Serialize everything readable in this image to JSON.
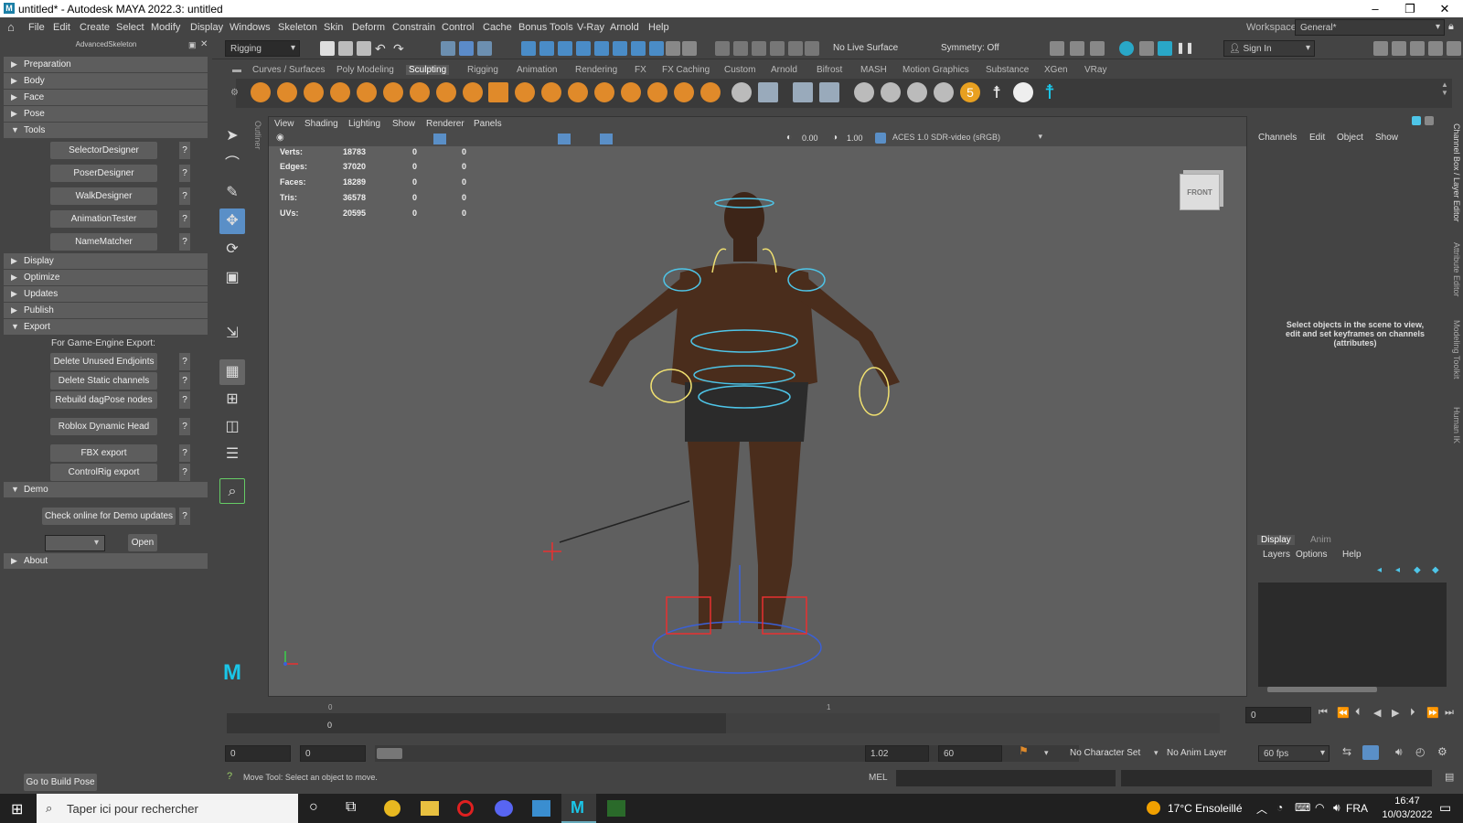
{
  "window": {
    "title": "untitled* - Autodesk MAYA 2022.3: untitled"
  },
  "menu": [
    "File",
    "Edit",
    "Create",
    "Select",
    "Modify",
    "Display",
    "Windows",
    "Skeleton",
    "Skin",
    "Deform",
    "Constrain",
    "Control",
    "Cache",
    "Bonus Tools",
    "V-Ray",
    "Arnold",
    "Help"
  ],
  "workspace": {
    "label": "Workspace:",
    "value": "General*"
  },
  "statusline": {
    "mode": "Rigging",
    "live_surface": "No Live Surface",
    "symmetry": "Symmetry: Off",
    "sign_in": "Sign In"
  },
  "left_panel": {
    "title": "AdvancedSkeleton",
    "frames": {
      "preparation": "Preparation",
      "body": "Body",
      "face": "Face",
      "pose": "Pose",
      "tools": "Tools",
      "display": "Display",
      "optimize": "Optimize",
      "updates": "Updates",
      "publish": "Publish",
      "export": "Export",
      "demo": "Demo",
      "about": "About"
    },
    "tools_buttons": [
      "SelectorDesigner",
      "PoserDesigner",
      "WalkDesigner",
      "AnimationTester",
      "NameMatcher"
    ],
    "export_label": "For Game-Engine Export:",
    "export_buttons": [
      "Delete Unused Endjoints",
      "Delete Static channels",
      "Rebuild dagPose nodes",
      "Roblox Dynamic Head",
      "FBX export",
      "ControlRig export"
    ],
    "demo_button": "Check online for Demo updates",
    "open_button": "Open",
    "build_pose": "Go to Build Pose",
    "q": "?"
  },
  "shelf_tabs": [
    "Curves / Surfaces",
    "Poly Modeling",
    "Sculpting",
    "Rigging",
    "Animation",
    "Rendering",
    "FX",
    "FX Caching",
    "Custom",
    "Arnold",
    "Bifrost",
    "MASH",
    "Motion Graphics",
    "Substance",
    "XGen",
    "VRay"
  ],
  "shelf_active": "Sculpting",
  "viewport": {
    "menu": [
      "View",
      "Shading",
      "Lighting",
      "Show",
      "Renderer",
      "Panels"
    ],
    "exposure": "0.00",
    "gamma": "1.00",
    "color_space": "ACES 1.0 SDR-video (sRGB)",
    "view_cube": "FRONT",
    "hud": [
      {
        "label": "Verts:",
        "a": "18783",
        "b": "0",
        "c": "0"
      },
      {
        "label": "Edges:",
        "a": "37020",
        "b": "0",
        "c": "0"
      },
      {
        "label": "Faces:",
        "a": "18289",
        "b": "0",
        "c": "0"
      },
      {
        "label": "Tris:",
        "a": "36578",
        "b": "0",
        "c": "0"
      },
      {
        "label": "UVs:",
        "a": "20595",
        "b": "0",
        "c": "0"
      }
    ]
  },
  "outliner_tab": "Outliner",
  "channel_box": {
    "menu": [
      "Channels",
      "Edit",
      "Object",
      "Show"
    ],
    "message": "Select objects in the scene to view, edit and set keyframes on channels (attributes)"
  },
  "layer_editor": {
    "tabs": [
      "Display",
      "Anim"
    ],
    "menu": [
      "Layers",
      "Options",
      "Help"
    ]
  },
  "side_tabs": [
    "Channel Box / Layer Editor",
    "Attribute Editor",
    "Modeling Toolkit",
    "Human IK"
  ],
  "timeline": {
    "start_tick": "0",
    "mid_tick": "1",
    "frame_label": "0",
    "current": "0"
  },
  "range": {
    "start": "0",
    "inner_start": "0",
    "inner_end": "1.02",
    "end": "60",
    "char_set": "No Character Set",
    "anim_layer": "No Anim Layer",
    "fps": "60 fps"
  },
  "help_line": "Move Tool: Select an object to move.",
  "mel": "MEL",
  "taskbar": {
    "search": "Taper ici pour rechercher",
    "weather": "17°C  Ensoleillé",
    "lang": "FRA",
    "time": "16:47",
    "date": "10/03/2022"
  }
}
